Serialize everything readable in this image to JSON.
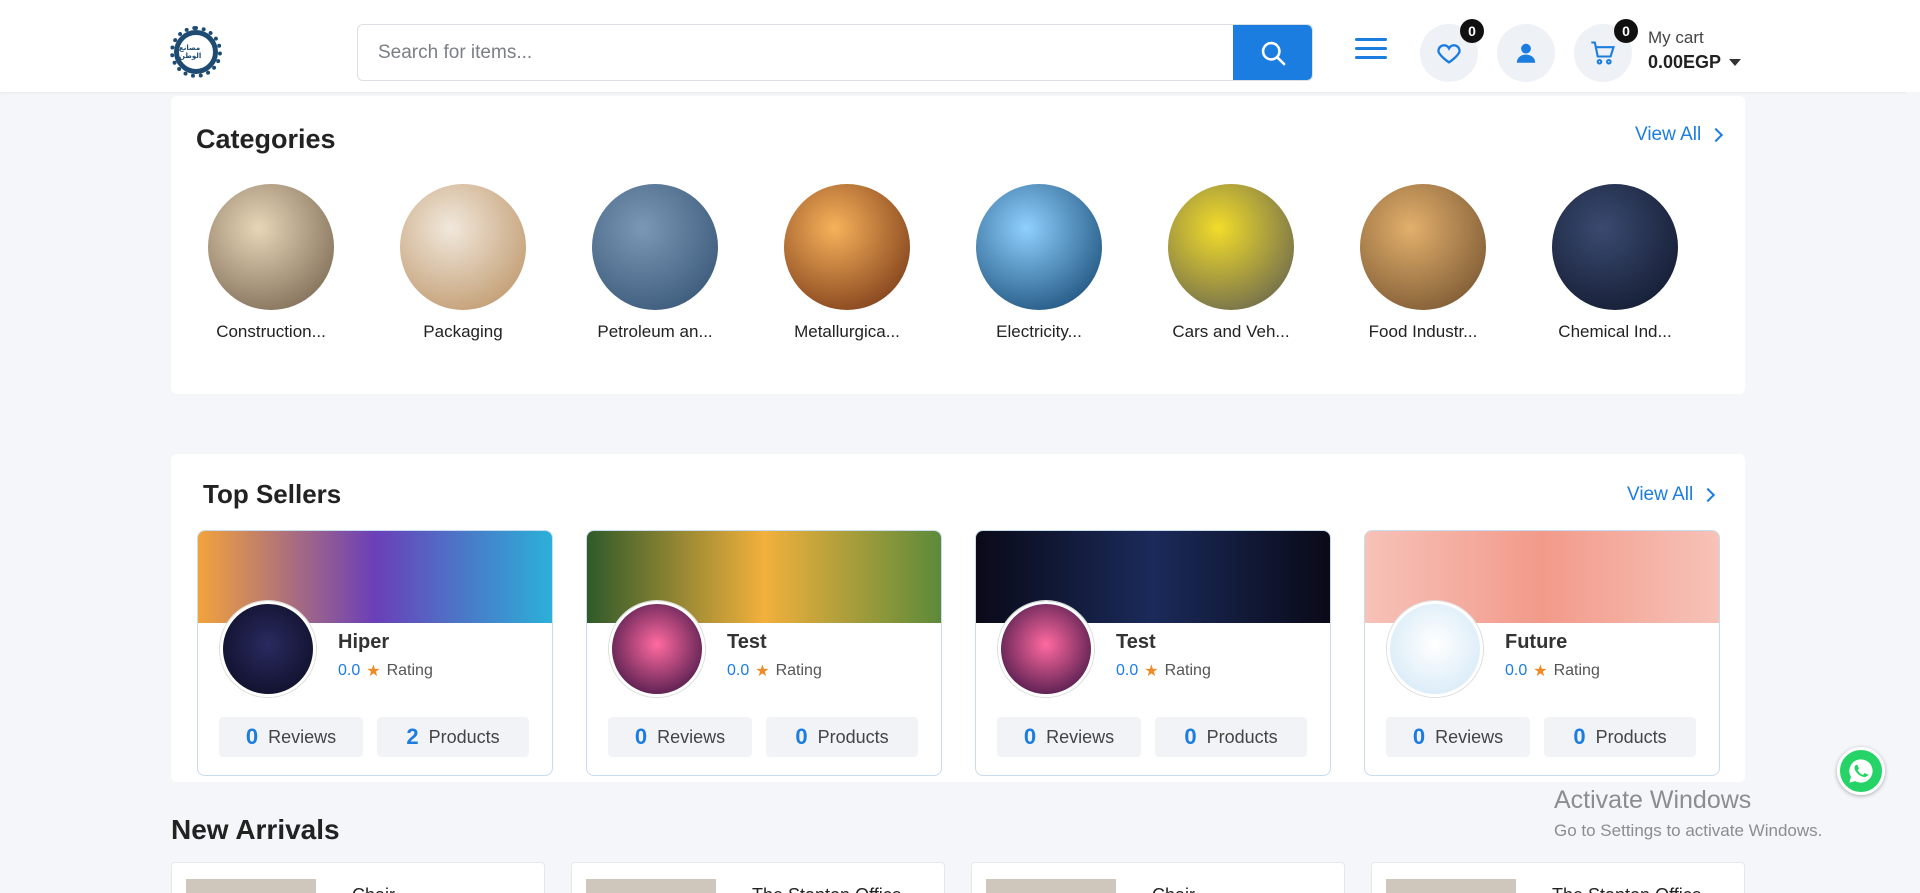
{
  "header": {
    "logo_text": "مصانع الوطن",
    "search_placeholder": "Search for items...",
    "wishlist_count": "0",
    "cart_count": "0",
    "cart_label": "My cart",
    "cart_total": "0.00EGP"
  },
  "categories": {
    "title": "Categories",
    "view_all": "View All",
    "items": [
      {
        "name": "Construction...",
        "colors": [
          "#e8d6b8",
          "#6d5a46"
        ]
      },
      {
        "name": "Packaging",
        "colors": [
          "#f1e8dc",
          "#b88d5c"
        ]
      },
      {
        "name": "Petroleum an...",
        "colors": [
          "#7b98b6",
          "#2f4d6e"
        ]
      },
      {
        "name": "Metallurgica...",
        "colors": [
          "#f7b25a",
          "#6a2a10"
        ]
      },
      {
        "name": "Electricity...",
        "colors": [
          "#8fd0ff",
          "#0a3c66"
        ]
      },
      {
        "name": "Cars and Veh...",
        "colors": [
          "#f2dc2a",
          "#555555"
        ]
      },
      {
        "name": "Food Industr...",
        "colors": [
          "#e3b06c",
          "#6a4a2a"
        ]
      },
      {
        "name": "Chemical Ind...",
        "colors": [
          "#3a4a70",
          "#0d1428"
        ]
      }
    ]
  },
  "top_sellers": {
    "title": "Top Sellers",
    "view_all": "View All",
    "rating_label": "Rating",
    "reviews_label": "Reviews",
    "products_label": "Products",
    "items": [
      {
        "name": "Hiper",
        "rating": "0.0",
        "reviews": "0",
        "products": "2",
        "banner": [
          "#f2a33c",
          "#6b3fb8",
          "#2bb0d8"
        ],
        "avatar": [
          "#2a2a60",
          "#0a0a20"
        ]
      },
      {
        "name": "Test",
        "rating": "0.0",
        "reviews": "0",
        "products": "0",
        "banner": [
          "#2f5a2a",
          "#f2b03c",
          "#5c8a3a"
        ],
        "avatar": [
          "#ff6aa0",
          "#2a0a3a"
        ]
      },
      {
        "name": "Test",
        "rating": "0.0",
        "reviews": "0",
        "products": "0",
        "banner": [
          "#0a0a18",
          "#1a2a5a",
          "#0a0a18"
        ],
        "avatar": [
          "#ff6aa0",
          "#2a0a3a"
        ]
      },
      {
        "name": "Future",
        "rating": "0.0",
        "reviews": "0",
        "products": "0",
        "banner": [
          "#f7c2b8",
          "#f29a8a",
          "#f7c2b8"
        ],
        "avatar": [
          "#ffffff",
          "#cfe6f5"
        ]
      }
    ]
  },
  "new_arrivals": {
    "title": "New Arrivals",
    "items": [
      {
        "name": "Chair"
      },
      {
        "name": "The Stanton Office"
      },
      {
        "name": "Chair"
      },
      {
        "name": "The Stanton Office"
      }
    ]
  },
  "watermark": {
    "line1": "Activate Windows",
    "line2": "Go to Settings to activate Windows."
  },
  "colors": {
    "accent": "#1b7de0",
    "star": "#f08a24",
    "whatsapp": "#25d366"
  }
}
